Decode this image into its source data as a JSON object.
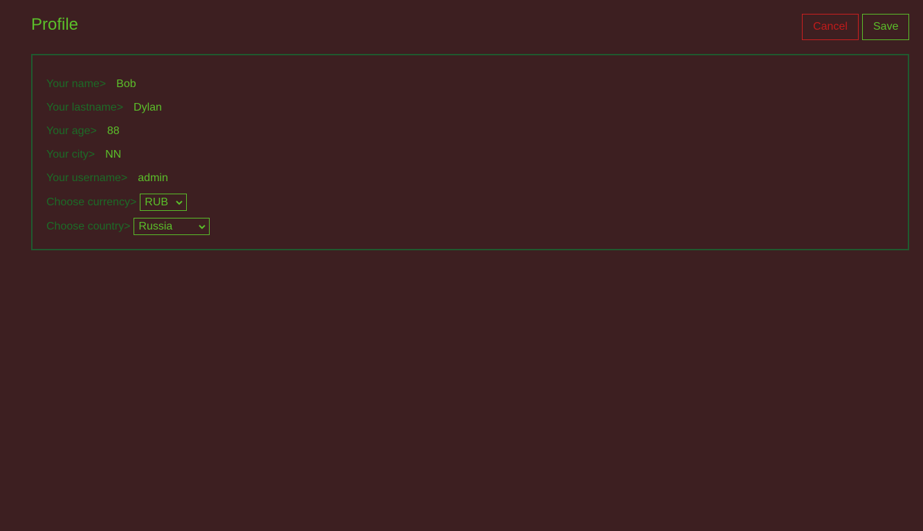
{
  "header": {
    "title": "Profile",
    "cancel_label": "Cancel",
    "save_label": "Save"
  },
  "profile": {
    "fields": [
      {
        "label": "Your name>",
        "value": "Bob"
      },
      {
        "label": "Your lastname>",
        "value": "Dylan"
      },
      {
        "label": "Your age>",
        "value": "88"
      },
      {
        "label": "Your city>",
        "value": "NN"
      },
      {
        "label": "Your username>",
        "value": "admin"
      }
    ],
    "currency": {
      "label": "Choose currency>",
      "selected": "RUB"
    },
    "country": {
      "label": "Choose country>",
      "selected": "Russia"
    }
  },
  "colors": {
    "background": "#3d1f21",
    "accent": "#5bbf2a",
    "label": "#1c6b27",
    "danger": "#c11b1b",
    "panel_border": "#1f5a2f"
  }
}
